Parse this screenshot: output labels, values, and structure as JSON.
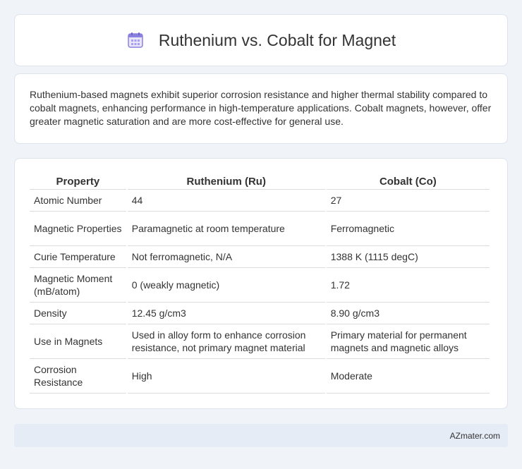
{
  "header": {
    "title": "Ruthenium vs. Cobalt for Magnet",
    "icon": "calendar-icon"
  },
  "summary": "Ruthenium-based magnets exhibit superior corrosion resistance and higher thermal stability compared to cobalt magnets, enhancing performance in high-temperature applications. Cobalt magnets, however, offer greater magnetic saturation and are more cost-effective for general use.",
  "table": {
    "headers": [
      "Property",
      "Ruthenium (Ru)",
      "Cobalt (Co)"
    ],
    "rows": [
      [
        "Atomic Number",
        "44",
        "27"
      ],
      [
        "Magnetic Properties",
        "Paramagnetic at room temperature",
        "Ferromagnetic"
      ],
      [
        "Curie Temperature",
        "Not ferromagnetic, N/A",
        "1388 K (1115 degC)"
      ],
      [
        "Magnetic Moment (mB/atom)",
        "0 (weakly magnetic)",
        "1.72"
      ],
      [
        "Density",
        "12.45 g/cm3",
        "8.90 g/cm3"
      ],
      [
        "Use in Magnets",
        "Used in alloy form to enhance corrosion resistance, not primary magnet material",
        "Primary material for permanent magnets and magnetic alloys"
      ],
      [
        "Corrosion Resistance",
        "High",
        "Moderate"
      ]
    ]
  },
  "footer": {
    "text": "AZmater.com"
  },
  "colors": {
    "background": "#f0f3f8",
    "card": "#ffffff",
    "footer_bg": "#e6ecf5",
    "icon_accent": "#7b6fd6"
  }
}
